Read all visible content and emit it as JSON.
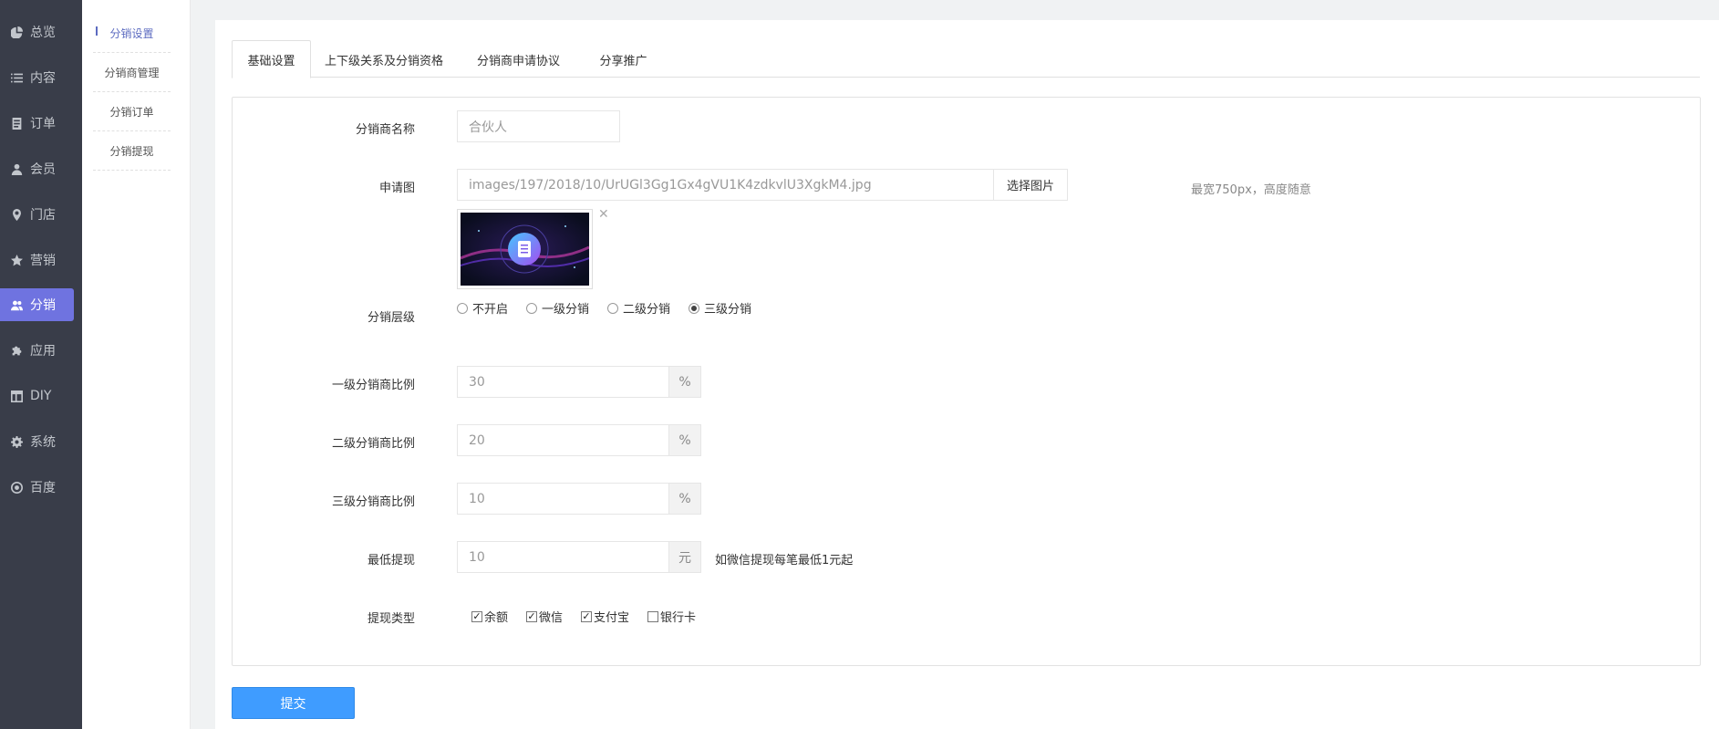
{
  "sidebar": {
    "items": [
      {
        "label": "总览",
        "icon": "pie-chart-icon"
      },
      {
        "label": "内容",
        "icon": "list-icon"
      },
      {
        "label": "订单",
        "icon": "document-icon"
      },
      {
        "label": "会员",
        "icon": "user-icon"
      },
      {
        "label": "门店",
        "icon": "map-pin-icon"
      },
      {
        "label": "营销",
        "icon": "star-icon"
      },
      {
        "label": "分销",
        "icon": "users-icon"
      },
      {
        "label": "应用",
        "icon": "puzzle-icon"
      },
      {
        "label": "DIY",
        "icon": "layout-icon"
      },
      {
        "label": "系统",
        "icon": "gear-icon"
      },
      {
        "label": "百度",
        "icon": "baidu-icon"
      }
    ],
    "active": "分销",
    "accent": "#6f73e0"
  },
  "subnav": {
    "items": [
      "分销设置",
      "分销商管理",
      "分销订单",
      "分销提现"
    ],
    "active": "分销设置"
  },
  "tabs": [
    "基础设置",
    "上下级关系及分销资格",
    "分销商申请协议",
    "分享推广"
  ],
  "form": {
    "name_label": "分销商名称",
    "name_placeholder": "合伙人",
    "image_label": "申请图",
    "image_path": "images/197/2018/10/UrUGl3Gg1Gx4gVU1K4zdkvlU3XgkM4.jpg",
    "choose_image": "选择图片",
    "image_hint": "最宽750px，高度随意",
    "image_close": "✕",
    "level_label": "分销层级",
    "level_options": [
      "不开启",
      "一级分销",
      "二级分销",
      "三级分销"
    ],
    "level_selected": "三级分销",
    "ratio1_label": "一级分销商比例",
    "ratio1_value": "30",
    "ratio2_label": "二级分销商比例",
    "ratio2_value": "20",
    "ratio3_label": "三级分销商比例",
    "ratio3_value": "10",
    "percent": "%",
    "min_withdraw_label": "最低提现",
    "min_withdraw_value": "10",
    "currency": "元",
    "min_withdraw_help": "如微信提现每笔最低1元起",
    "withdraw_type_label": "提现类型",
    "withdraw_types": [
      {
        "label": "余额",
        "checked": true
      },
      {
        "label": "微信",
        "checked": true
      },
      {
        "label": "支付宝",
        "checked": true
      },
      {
        "label": "银行卡",
        "checked": false
      }
    ],
    "submit": "提交",
    "submit_color": "#3f9cff"
  }
}
